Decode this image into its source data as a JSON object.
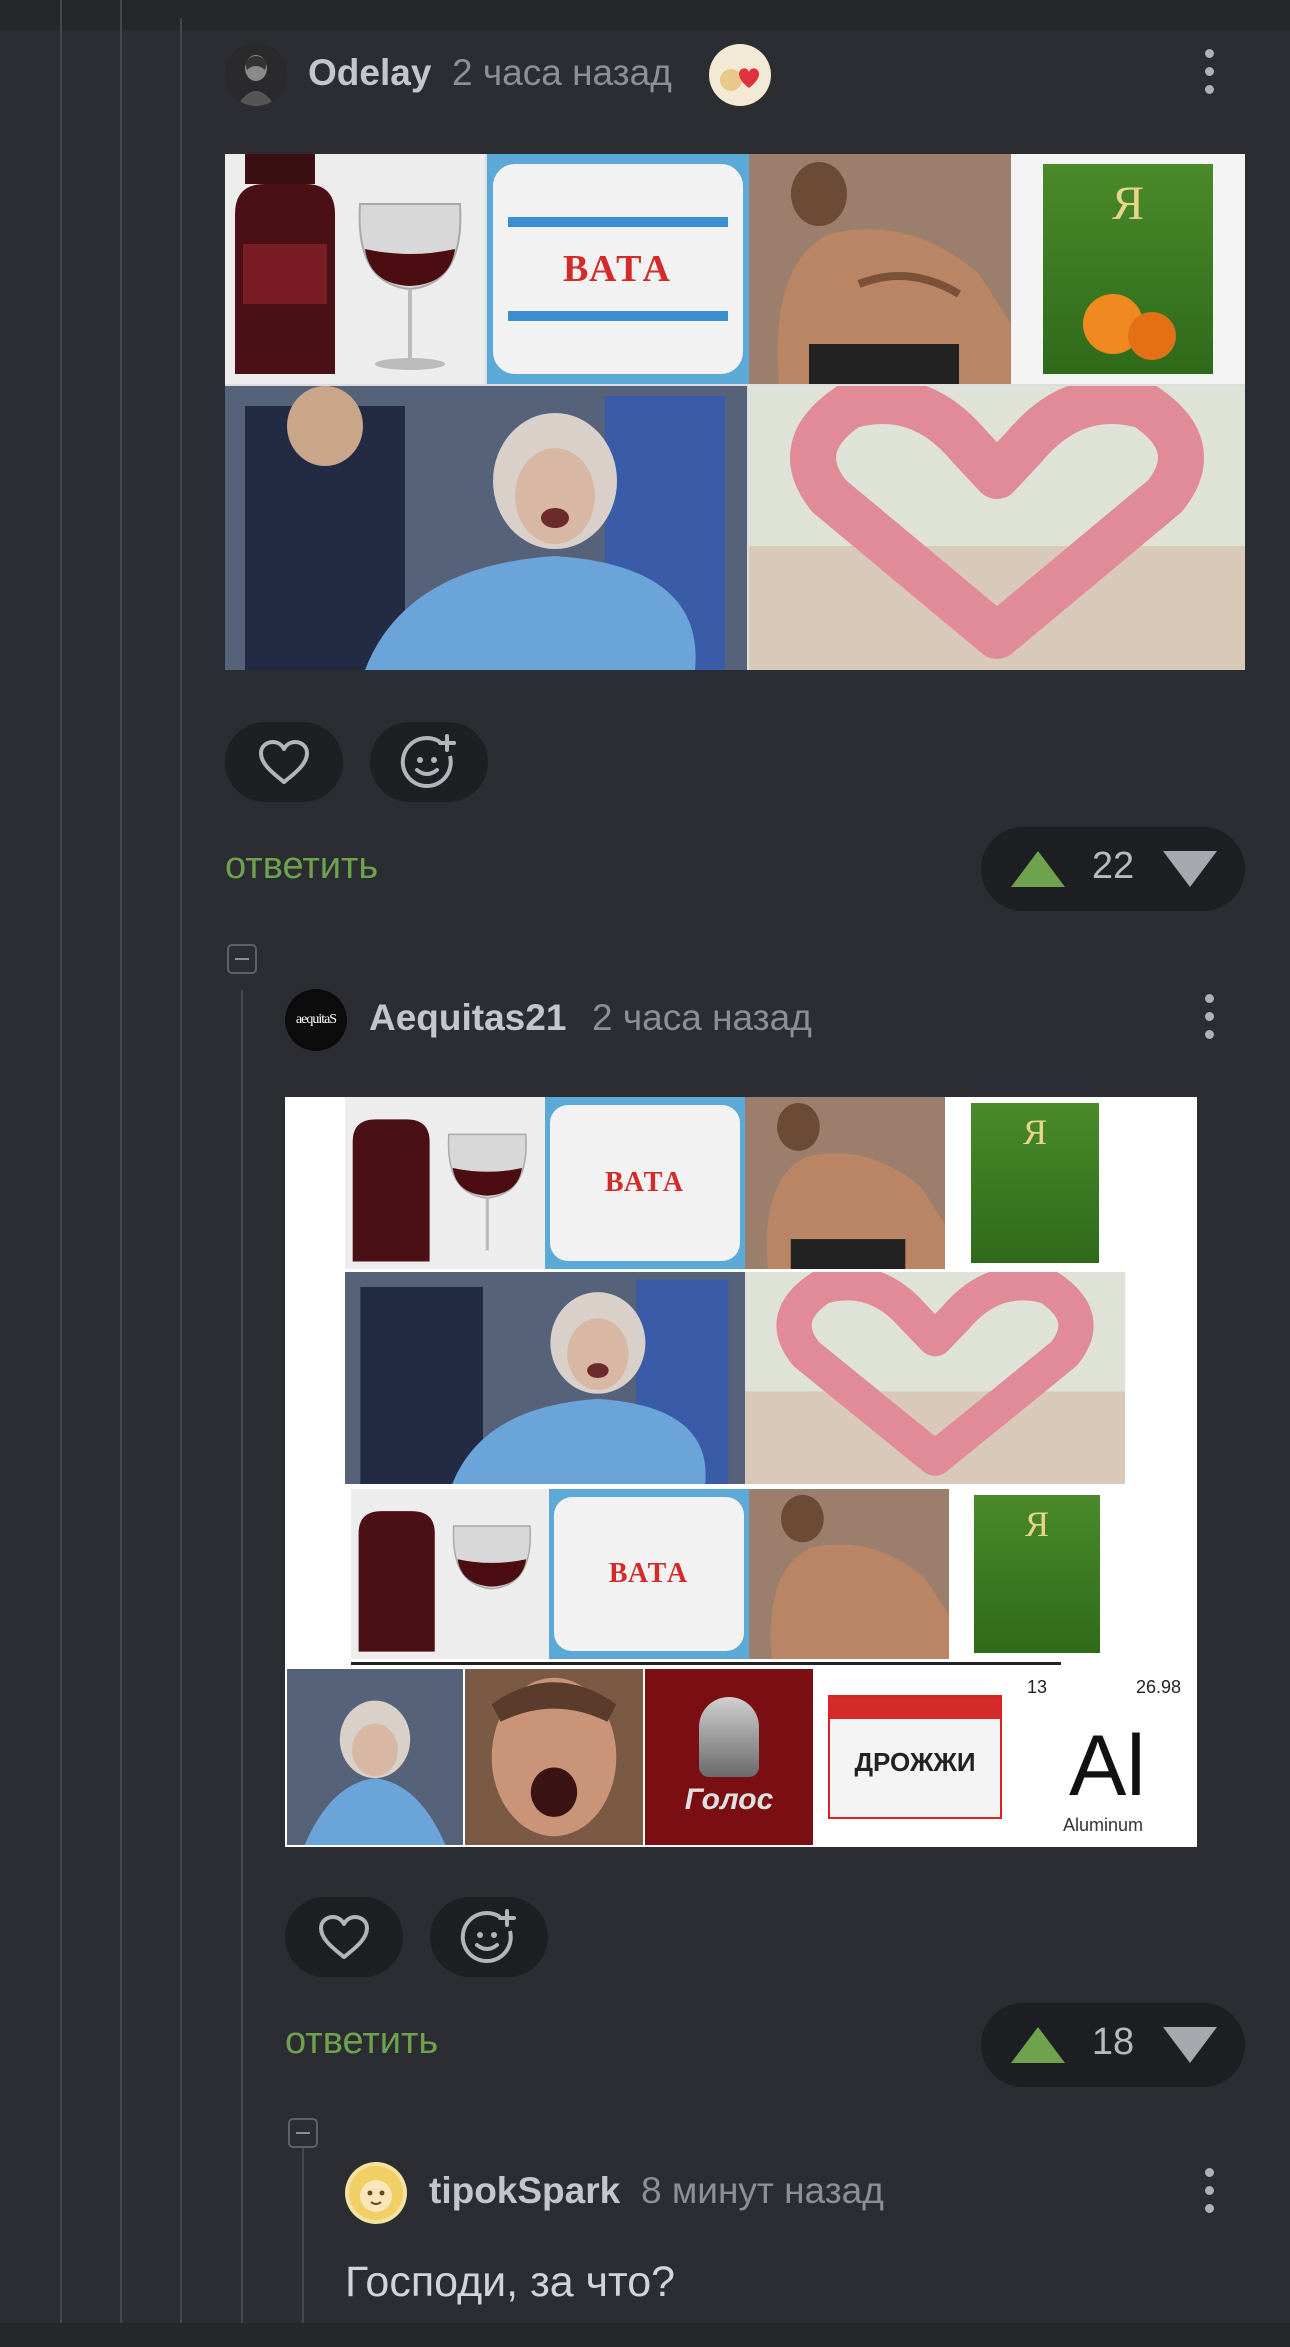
{
  "comments": [
    {
      "user": "Odelay",
      "time": "2 часа назад",
      "reply_label": "ответить",
      "rating": "22",
      "collage_labels": {
        "vata": "ВАТА",
        "juice": "Я"
      }
    },
    {
      "user": "Aequitas21",
      "avatar_text": "aequitaS",
      "time": "2 часа назад",
      "reply_label": "ответить",
      "rating": "18",
      "collage_labels": {
        "vata": "ВАТА",
        "juice": "Я",
        "golos": "Голос",
        "drozhzhi": "ДРОЖЖИ",
        "element_number": "13",
        "element_mass": "26.98",
        "element_symbol": "Al",
        "element_name": "Aluminum"
      }
    },
    {
      "user": "tipokSpark",
      "time": "8 минут назад",
      "text": "Господи, за что?"
    }
  ],
  "icons": {
    "like": "heart-icon",
    "reaction": "add-emoji-icon",
    "more": "more-vertical-icon",
    "upvote": "upvote-arrow-icon",
    "downvote": "downvote-arrow-icon",
    "collapse": "collapse-thread-icon",
    "award": "award-badge-icon"
  },
  "colors": {
    "background": "#2b2d32",
    "accent_green": "#6fa24d",
    "pill_bg": "#1e1f23",
    "thread_line": "#44474d"
  }
}
